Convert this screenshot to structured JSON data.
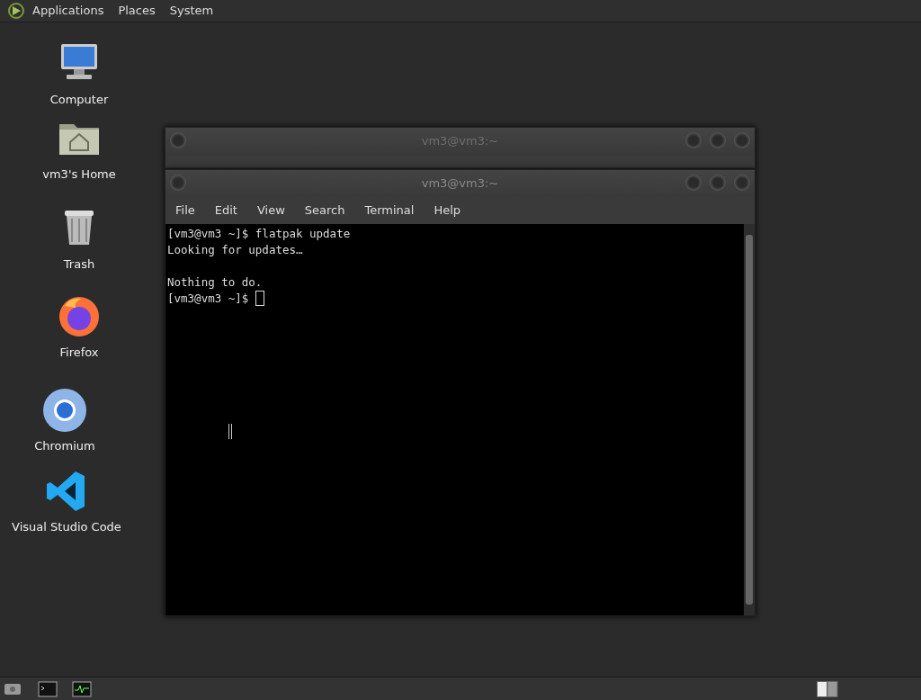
{
  "top_panel": {
    "menus": [
      "Applications",
      "Places",
      "System"
    ]
  },
  "desktop_icons": [
    {
      "label": "Computer",
      "kind": "computer"
    },
    {
      "label": "vm3's Home",
      "kind": "home"
    },
    {
      "label": "Trash",
      "kind": "trash"
    },
    {
      "label": "Firefox",
      "kind": "firefox"
    },
    {
      "label": "Chromium",
      "kind": "chromium"
    },
    {
      "label": "Visual Studio Code",
      "kind": "vscode"
    }
  ],
  "windows": [
    {
      "title": "vm3@vm3:~",
      "focused": false
    },
    {
      "title": "vm3@vm3:~",
      "menus": [
        "File",
        "Edit",
        "View",
        "Search",
        "Terminal",
        "Help"
      ],
      "focused": true,
      "lines": [
        {
          "text": "[vm3@vm3 ~]$ flatpak update",
          "blank_before": false,
          "cursor": false
        },
        {
          "text": "Looking for updates…",
          "blank_before": false,
          "cursor": false
        },
        {
          "text": "Nothing to do.",
          "blank_before": true,
          "cursor": false
        },
        {
          "text": "[vm3@vm3 ~]$ ",
          "blank_before": false,
          "cursor": true
        }
      ]
    }
  ]
}
